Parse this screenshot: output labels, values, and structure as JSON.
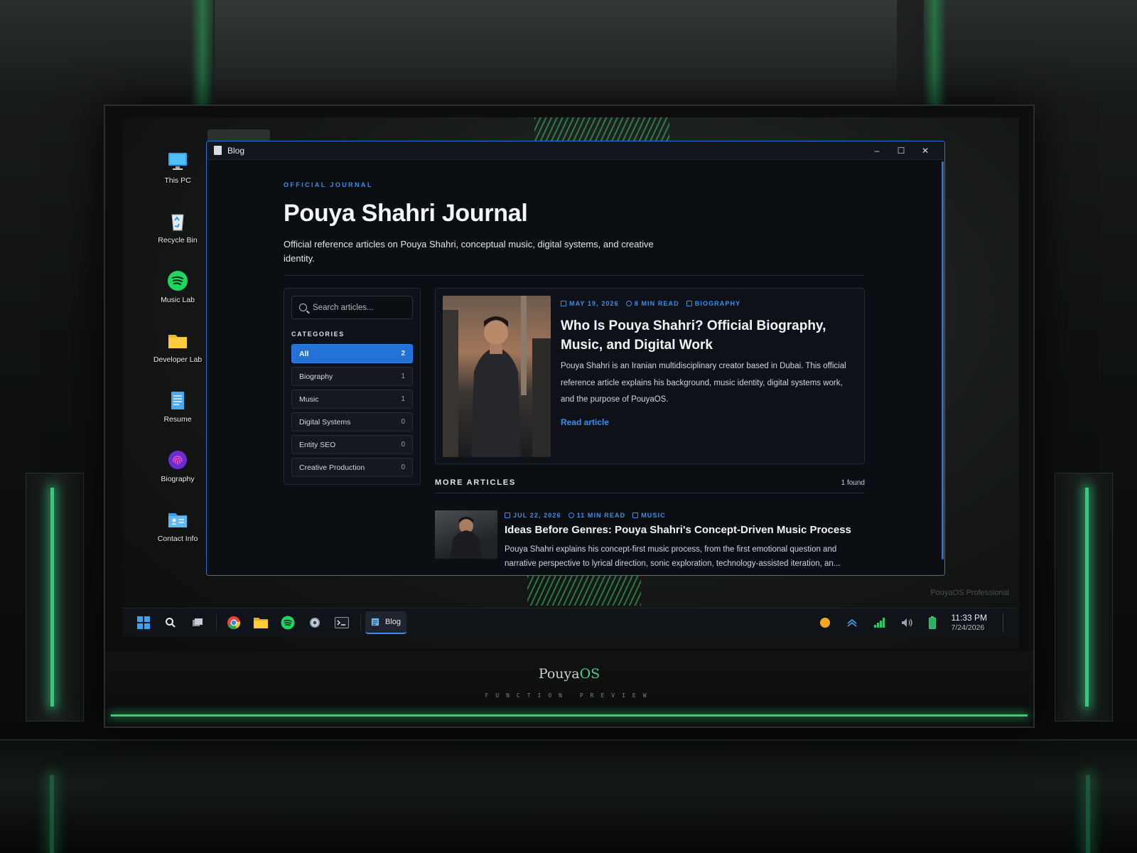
{
  "brand": {
    "name_main": "Pouya",
    "name_accent": "OS",
    "subtitle": "FUNCTION PREVIEW"
  },
  "desktop": {
    "watermark": "PouyaOS Professional",
    "icons": [
      {
        "label": "This PC",
        "icon": "monitor-icon"
      },
      {
        "label": "Recycle Bin",
        "icon": "recycle-bin-icon"
      },
      {
        "label": "Music Lab",
        "icon": "spotify-icon"
      },
      {
        "label": "Developer Lab",
        "icon": "folder-icon"
      },
      {
        "label": "Resume",
        "icon": "notepad-icon"
      },
      {
        "label": "Biography",
        "icon": "fingerprint-icon"
      },
      {
        "label": "Contact Info",
        "icon": "contact-card-icon"
      }
    ]
  },
  "window": {
    "title": "Blog",
    "controls": {
      "minimize": "–",
      "maximize": "☐",
      "close": "✕"
    }
  },
  "page": {
    "eyebrow": "OFFICIAL JOURNAL",
    "title": "Pouya Shahri Journal",
    "description": "Official reference articles on Pouya Shahri, conceptual music, digital systems, and creative identity."
  },
  "sidebar": {
    "search_placeholder": "Search articles...",
    "categories_title": "CATEGORIES",
    "categories": [
      {
        "label": "All",
        "count": "2",
        "active": true
      },
      {
        "label": "Biography",
        "count": "1"
      },
      {
        "label": "Music",
        "count": "1"
      },
      {
        "label": "Digital Systems",
        "count": "0"
      },
      {
        "label": "Entity SEO",
        "count": "0"
      },
      {
        "label": "Creative Production",
        "count": "0"
      }
    ]
  },
  "featured": {
    "date": "MAY 19, 2026",
    "read_time": "8 MIN READ",
    "category": "BIOGRAPHY",
    "title": "Who Is Pouya Shahri? Official Biography, Music, and Digital Work",
    "body": "Pouya Shahri is an Iranian multidisciplinary creator based in Dubai. This official reference article explains his background, music identity, digital systems work, and the purpose of PouyaOS.",
    "cta": "Read article"
  },
  "more": {
    "heading": "MORE ARTICLES",
    "found": "1 found",
    "items": [
      {
        "date": "JUL 22, 2026",
        "read_time": "11 MIN READ",
        "category": "MUSIC",
        "title": "Ideas Before Genres: Pouya Shahri's Concept-Driven Music Process",
        "body": "Pouya Shahri explains his concept-first music process, from the first emotional question and narrative perspective to lyrical direction, sonic exploration, technology-assisted iteration, an..."
      }
    ]
  },
  "taskbar": {
    "active_app": "Blog",
    "time": "11:33 PM",
    "date": "7/24/2026"
  },
  "colors": {
    "accent": "#2272d8",
    "link": "#3b8fe6",
    "green": "#2fd07a"
  }
}
